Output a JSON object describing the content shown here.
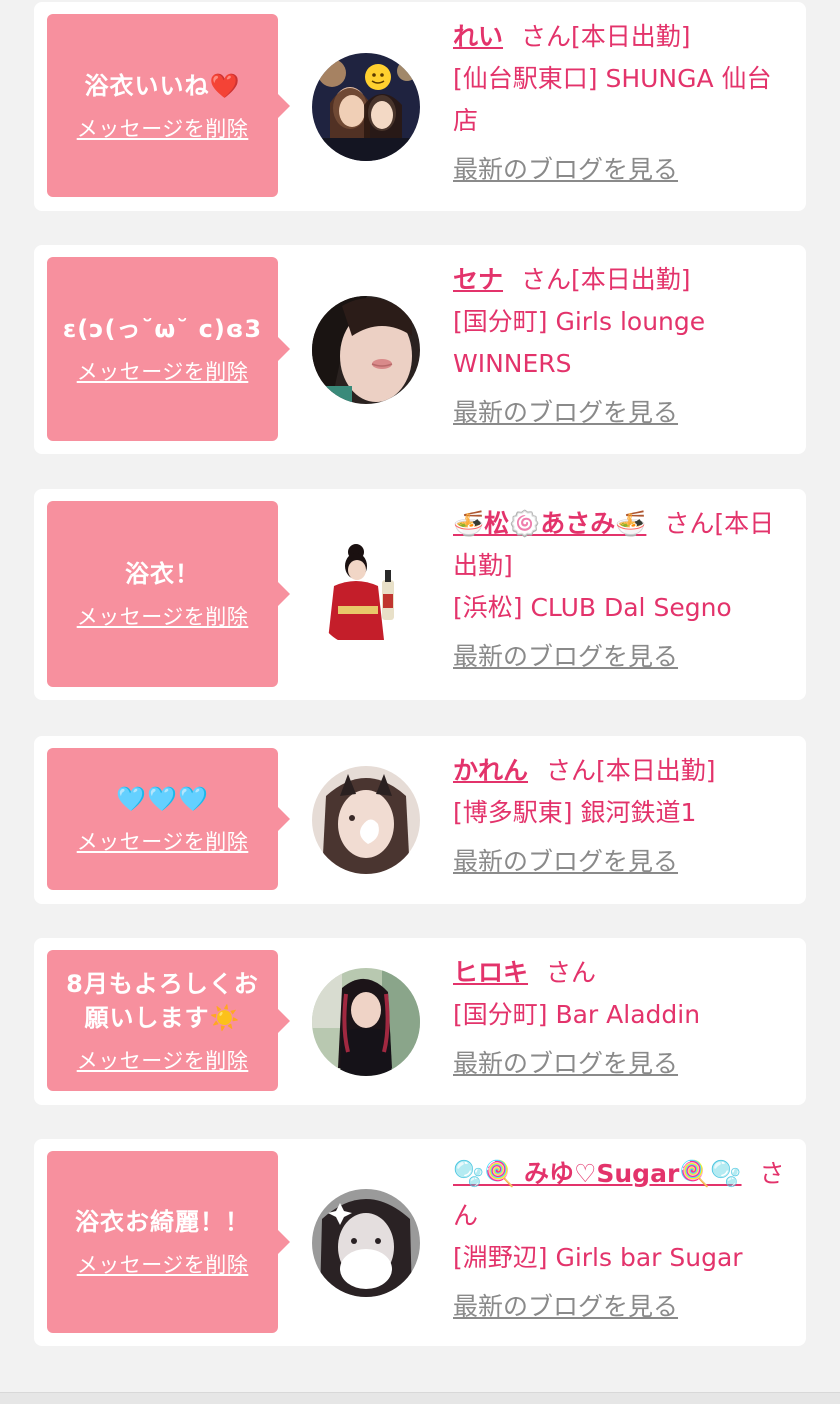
{
  "common": {
    "delete_label": "メッセージを削除",
    "blog_label": "最新のブログを見る",
    "san": "さん"
  },
  "cards": [
    {
      "message": "浴衣いいね❤️",
      "name": "れい",
      "status": "[本日出勤]",
      "shop": "[仙台駅東口] SHUNGA 仙台店",
      "avatar_icon": "avatar-photo-icon"
    },
    {
      "message": "ɛ(ɔ(っ˘ω˘ c)ɞ3",
      "name": "セナ",
      "status": "[本日出勤]",
      "shop": "[国分町] Girls lounge WINNERS",
      "avatar_icon": "avatar-photo-icon"
    },
    {
      "message": "浴衣！",
      "name": "🍜松🍥あさみ🍜",
      "status": "[本日出勤]",
      "shop": "[浜松] CLUB Dal Segno",
      "avatar_icon": "avatar-photo-icon"
    },
    {
      "message": "🩵🩵🩵",
      "name": "かれん",
      "status": "[本日出勤]",
      "shop": "[博多駅東] 銀河鉄道1",
      "avatar_icon": "avatar-photo-icon"
    },
    {
      "message": "8月もよろしくお願いします☀️",
      "name": "ヒロキ",
      "status": "",
      "shop": "[国分町] Bar Aladdin",
      "avatar_icon": "avatar-photo-icon"
    },
    {
      "message": "浴衣お綺麗！！",
      "name": "🫧🍭 みゆ♡Sugar🍭🫧",
      "status": "",
      "shop": "[淵野辺] Girls bar Sugar",
      "avatar_icon": "avatar-photo-icon"
    }
  ],
  "colors": {
    "bubble": "#f7909e",
    "accent": "#e3336b",
    "link_gray": "#8a8a8a",
    "background": "#f2f2f2"
  }
}
